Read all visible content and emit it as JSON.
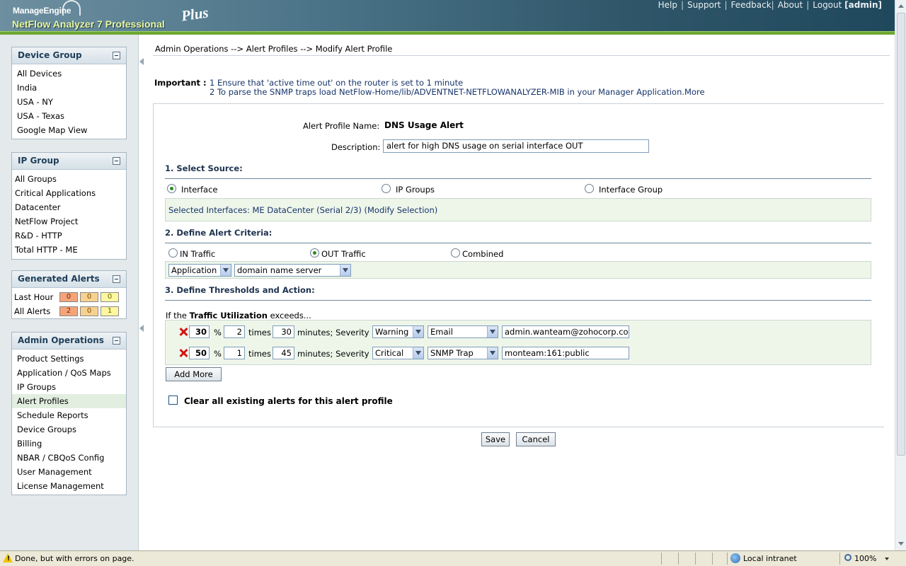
{
  "header": {
    "logo_top": "ManageEngine",
    "logo_bottom": "NetFlow Analyzer 7 Professional",
    "logo_plus": "Plus",
    "links": [
      "Help",
      "Support",
      "Feedback",
      "About"
    ],
    "logout": "Logout",
    "user": "[admin]"
  },
  "sidebar": {
    "device_group": {
      "title": "Device Group",
      "items": [
        "All Devices",
        "India",
        "USA - NY",
        "USA - Texas",
        "Google Map View"
      ]
    },
    "ip_group": {
      "title": "IP Group",
      "items": [
        "All Groups",
        "Critical Applications",
        "Datacenter",
        "NetFlow Project",
        "R&D - HTTP",
        "Total HTTP - ME"
      ]
    },
    "generated_alerts": {
      "title": "Generated Alerts",
      "last_hour": {
        "label": "Last Hour",
        "values": [
          "0",
          "0",
          "0"
        ]
      },
      "all_alerts": {
        "label": "All Alerts",
        "values": [
          "2",
          "0",
          "1"
        ]
      },
      "colors": {
        "critical": "#f4a47a",
        "major": "#f7d190",
        "warning": "#fdf7a0"
      }
    },
    "admin_operations": {
      "title": "Admin Operations",
      "items": [
        "Product Settings",
        "Application / QoS Maps",
        "IP Groups",
        "Alert Profiles",
        "Schedule Reports",
        "Device Groups",
        "Billing",
        "NBAR / CBQoS Config",
        "User Management",
        "License Management"
      ],
      "selected": "Alert Profiles"
    }
  },
  "main": {
    "breadcrumb": "Admin Operations --> Alert Profiles --> Modify Alert Profile",
    "important_label": "Important :",
    "important_1": "1 Ensure that 'active time out' on the router is set to 1 minute",
    "important_2": "2 To parse the SNMP traps load NetFlow-Home/lib/ADVENTNET-NETFLOWANALYZER-MIB in your Manager Application.More",
    "profile_name_label": "Alert Profile Name:",
    "profile_name": "DNS Usage Alert",
    "description_label": "Description:",
    "description": "alert for high DNS usage on serial interface OUT",
    "section1": "1. Select Source:",
    "source_options": [
      "Interface",
      "IP Groups",
      "Interface Group"
    ],
    "source_selected": "Interface",
    "selected_interfaces": "Selected Interfaces: ME DataCenter (Serial 2/3) (Modify Selection)",
    "section2": "2. Define Alert Criteria:",
    "traffic_options": [
      "IN Traffic",
      "OUT Traffic",
      "Combined"
    ],
    "traffic_selected": "OUT Traffic",
    "criteria_type": "Application",
    "criteria_value": "domain name server",
    "section3": "3. Define Thresholds and Action:",
    "if_prefix": "If the ",
    "if_metric": "Traffic Utilization",
    "if_suffix": " exceeds...",
    "thresholds": [
      {
        "percent": "30",
        "times": "2",
        "minutes": "30",
        "severity": "Warning",
        "action": "Email",
        "target": "admin.wanteam@zohocorp.com"
      },
      {
        "percent": "50",
        "times": "1",
        "minutes": "45",
        "severity": "Critical",
        "action": "SNMP Trap",
        "target": "monteam:161:public"
      }
    ],
    "pct_sym": "%",
    "times_word": "times",
    "minutes_word": "minutes; Severity",
    "add_more": "Add More",
    "clear_label": "Clear all existing alerts for this alert profile",
    "save": "Save",
    "cancel": "Cancel"
  },
  "statusbar": {
    "message": "Done, but with errors on page.",
    "zone": "Local intranet",
    "zoom": "100%"
  }
}
